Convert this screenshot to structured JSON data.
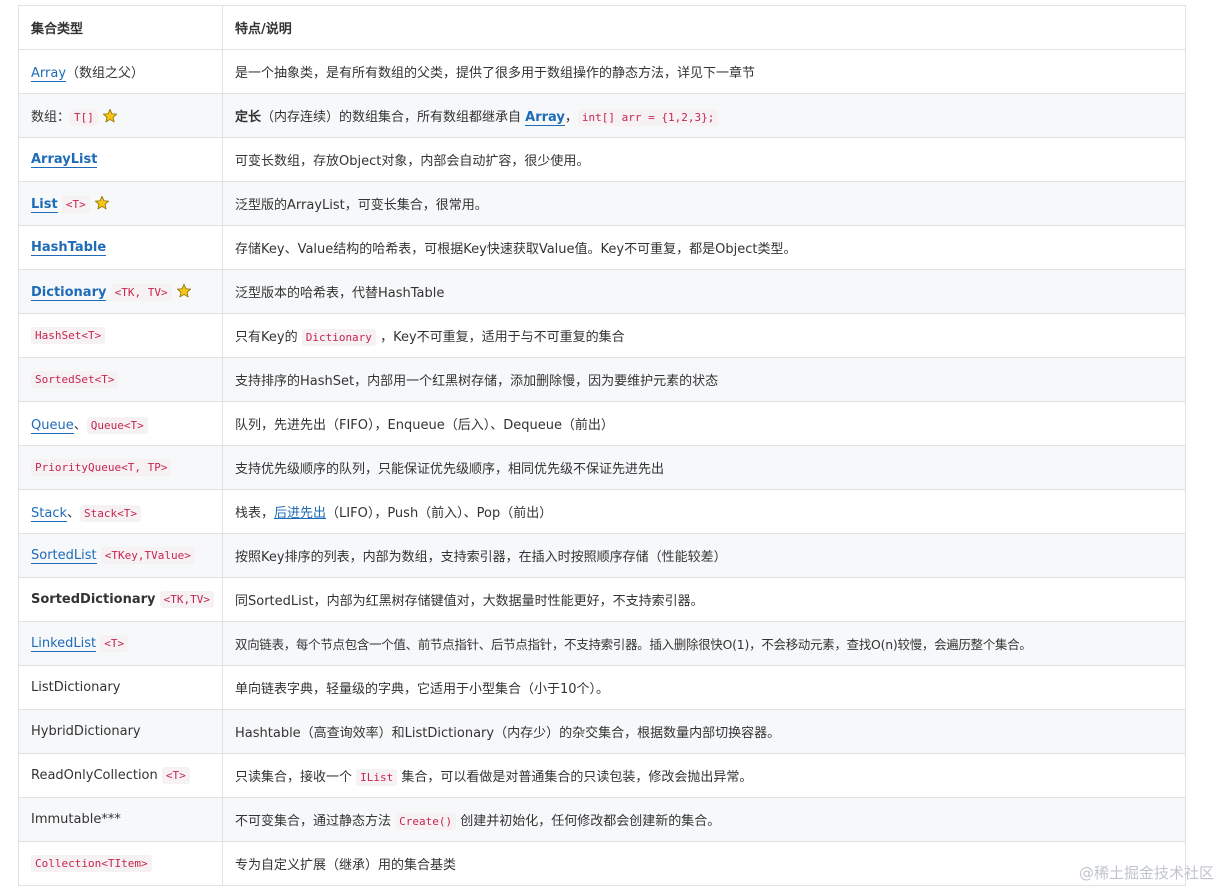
{
  "header": {
    "col1": "集合类型",
    "col2": "特点/说明"
  },
  "rows": [
    {
      "name": "Array",
      "suffix": "（数组之父）",
      "desc": "是一个抽象类，是有所有数组的父类，提供了很多用于数组操作的静态方法，详见下一章节"
    },
    {
      "prefix": "数组：",
      "code": "T[]",
      "desc_bold": "定长",
      "desc_a": "（内存连续）的数组集合，所有数组都继承自 ",
      "desc_link": "Array",
      "desc_sep": "，",
      "desc_code": "int[] arr = {1,2,3};"
    },
    {
      "name": "ArrayList",
      "desc": "可变长数组，存放Object对象，内部会自动扩容，很少使用。"
    },
    {
      "name": "List",
      "code": "<T>",
      "desc": "泛型版的ArrayList，可变长集合，很常用。"
    },
    {
      "name": "HashTable",
      "desc": "存储Key、Value结构的哈希表，可根据Key快速获取Value值。Key不可重复，都是Object类型。"
    },
    {
      "name": "Dictionary",
      "code": "<TK, TV>",
      "desc": "泛型版本的哈希表，代替HashTable"
    },
    {
      "code": "HashSet<T>",
      "desc_a": "只有Key的 ",
      "desc_code": "Dictionary",
      "desc_b": " ，Key不可重复，适用于与不可重复的集合"
    },
    {
      "code": "SortedSet<T>",
      "desc": "支持排序的HashSet，内部用一个红黑树存储，添加删除慢，因为要维护元素的状态"
    },
    {
      "name": "Queue",
      "sep": "、",
      "code": "Queue<T>",
      "desc": "队列，先进先出（FIFO），Enqueue（后入）、Dequeue（前出）"
    },
    {
      "code": "PriorityQueue<T, TP>",
      "desc": "支持优先级顺序的队列，只能保证优先级顺序，相同优先级不保证先进先出"
    },
    {
      "name": "Stack",
      "sep": "、",
      "code": "Stack<T>",
      "desc_a": "栈表，",
      "desc_link": "后进先出",
      "desc_b": "（LIFO），Push（前入）、Pop（前出）"
    },
    {
      "name": "SortedList",
      "code": "<TKey,TValue>",
      "desc": "按照Key排序的列表，内部为数组，支持索引器，在插入时按照顺序存储（性能较差）"
    },
    {
      "name": "SortedDictionary",
      "code": "<TK,TV>",
      "desc": "同SortedList，内部为红黑树存储键值对，大数据量时性能更好，不支持索引器。"
    },
    {
      "name": "LinkedList",
      "code": "<T>",
      "desc": "双向链表，每个节点包含一个值、前节点指针、后节点指针，不支持索引器。插入删除很快O(1)，不会移动元素，查找O(n)较慢，会遍历整个集合。"
    },
    {
      "name": "ListDictionary",
      "desc": "单向链表字典，轻量级的字典，它适用于小型集合（小于10个）。"
    },
    {
      "name": "HybridDictionary",
      "desc": "Hashtable（高查询效率）和ListDictionary（内存少）的杂交集合，根据数量内部切换容器。"
    },
    {
      "name": "ReadOnlyCollection",
      "code": "<T>",
      "desc_a": "只读集合，接收一个 ",
      "desc_code": "IList",
      "desc_b": " 集合，可以看做是对普通集合的只读包装，修改会抛出异常。"
    },
    {
      "name": "Immutable***",
      "desc_a": "不可变集合，通过静态方法 ",
      "desc_code": "Create()",
      "desc_b": " 创建并初始化，任何修改都会创建新的集合。"
    },
    {
      "code": "Collection<TItem>",
      "desc": "专为自定义扩展（继承）用的集合基类"
    }
  ],
  "watermark": "@稀土掘金技术社区",
  "colors": {
    "link": "#1e6bb8",
    "code_text": "#c7254e",
    "code_bg": "#f6f2f4",
    "star": "#f5c518"
  },
  "icons": [
    "star-icon"
  ]
}
